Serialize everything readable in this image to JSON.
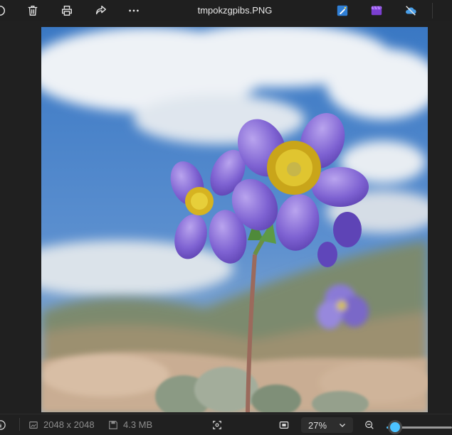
{
  "toolbar": {
    "filename": "tmpokzgpibs.PNG",
    "left_icons": [
      "rotate-icon",
      "delete-icon",
      "print-icon",
      "share-icon",
      "more-icon"
    ],
    "right_icons": [
      "edit-image-icon",
      "clipchamp-icon",
      "onedrive-offline-icon"
    ]
  },
  "image": {
    "subject_icon": "flower-photo"
  },
  "statusbar": {
    "dimensions": "2048 x 2048",
    "filesize": "4.3 MB",
    "zoom": "27%",
    "zoom_level": 0.1,
    "accent": "#4cc2ff"
  }
}
